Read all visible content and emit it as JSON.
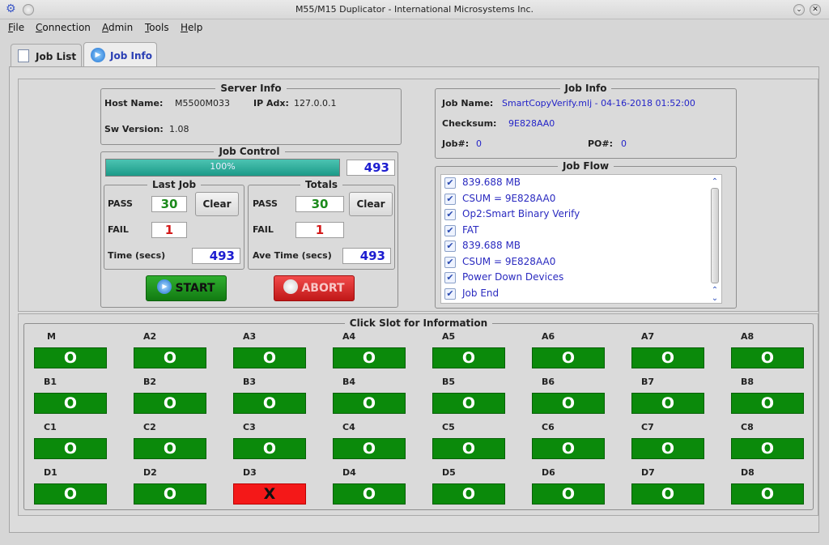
{
  "window": {
    "title": "M55/M15 Duplicator - International Microsystems Inc."
  },
  "menu": [
    "File",
    "Connection",
    "Admin",
    "Tools",
    "Help"
  ],
  "tabs": [
    {
      "label": "Job List",
      "icon": "document-icon",
      "active": false
    },
    {
      "label": "Job Info",
      "icon": "play-icon",
      "active": true
    }
  ],
  "server_info": {
    "title": "Server Info",
    "host_label": "Host Name:",
    "host_value": "M5500M033",
    "ip_label": "IP Adx:",
    "ip_value": "127.0.0.1",
    "sw_label": "Sw Version:",
    "sw_value": "1.08"
  },
  "job_info": {
    "title": "Job Info",
    "name_label": "Job Name:",
    "name_value": "SmartCopyVerify.mlj - 04-16-2018 01:52:00",
    "checksum_label": "Checksum:",
    "checksum_value": "9E828AA0",
    "jobno_label": "Job#:",
    "jobno_value": "0",
    "po_label": "PO#:",
    "po_value": "0"
  },
  "job_control": {
    "title": "Job Control",
    "progress_label": "100%",
    "progress_fraction": 1.0,
    "total_count": "493",
    "last_job": {
      "title": "Last Job",
      "pass_label": "PASS",
      "pass_value": "30",
      "fail_label": "FAIL",
      "fail_value": "1",
      "time_label": "Time (secs)",
      "time_value": "493",
      "clear_label": "Clear"
    },
    "totals": {
      "title": "Totals",
      "pass_label": "PASS",
      "pass_value": "30",
      "fail_label": "FAIL",
      "fail_value": "1",
      "time_label": "Ave Time (secs)",
      "time_value": "493",
      "clear_label": "Clear"
    },
    "start_label": "START",
    "abort_label": "ABORT"
  },
  "job_flow": {
    "title": "Job Flow",
    "items": [
      "839.688 MB",
      "CSUM = 9E828AA0",
      "Op2:Smart Binary Verify",
      "FAT",
      "839.688 MB",
      "CSUM = 9E828AA0",
      "Power Down Devices",
      "Job End"
    ]
  },
  "slots": {
    "title": "Click Slot for Information",
    "rows": [
      [
        {
          "label": "M",
          "status": "O"
        },
        {
          "label": "A2",
          "status": "O"
        },
        {
          "label": "A3",
          "status": "O"
        },
        {
          "label": "A4",
          "status": "O"
        },
        {
          "label": "A5",
          "status": "O"
        },
        {
          "label": "A6",
          "status": "O"
        },
        {
          "label": "A7",
          "status": "O"
        },
        {
          "label": "A8",
          "status": "O"
        }
      ],
      [
        {
          "label": "B1",
          "status": "O"
        },
        {
          "label": "B2",
          "status": "O"
        },
        {
          "label": "B3",
          "status": "O"
        },
        {
          "label": "B4",
          "status": "O"
        },
        {
          "label": "B5",
          "status": "O"
        },
        {
          "label": "B6",
          "status": "O"
        },
        {
          "label": "B7",
          "status": "O"
        },
        {
          "label": "B8",
          "status": "O"
        }
      ],
      [
        {
          "label": "C1",
          "status": "O"
        },
        {
          "label": "C2",
          "status": "O"
        },
        {
          "label": "C3",
          "status": "O"
        },
        {
          "label": "C4",
          "status": "O"
        },
        {
          "label": "C5",
          "status": "O"
        },
        {
          "label": "C6",
          "status": "O"
        },
        {
          "label": "C7",
          "status": "O"
        },
        {
          "label": "C8",
          "status": "O"
        }
      ],
      [
        {
          "label": "D1",
          "status": "O"
        },
        {
          "label": "D2",
          "status": "O"
        },
        {
          "label": "D3",
          "status": "X"
        },
        {
          "label": "D4",
          "status": "O"
        },
        {
          "label": "D5",
          "status": "O"
        },
        {
          "label": "D6",
          "status": "O"
        },
        {
          "label": "D7",
          "status": "O"
        },
        {
          "label": "D8",
          "status": "O"
        }
      ]
    ]
  },
  "colors": {
    "slot_ok": "#0b8a0b",
    "slot_fail": "#f41818",
    "start": "#1f951f",
    "abort": "#dd2a2a",
    "progress": "#2aa895",
    "link_blue": "#2424c8"
  }
}
